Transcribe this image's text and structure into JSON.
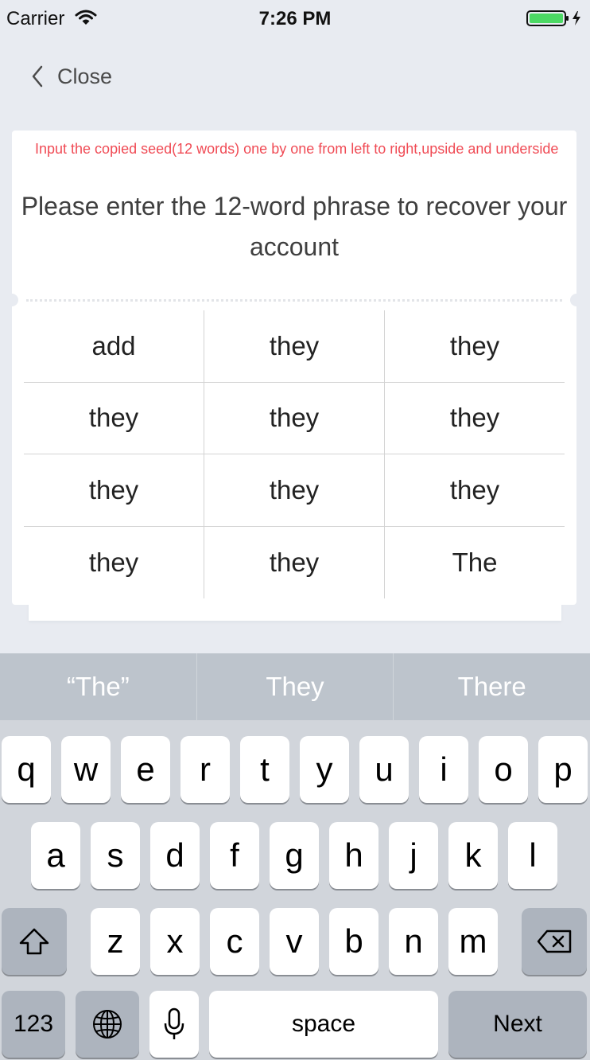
{
  "status": {
    "carrier": "Carrier",
    "time": "7:26 PM"
  },
  "nav": {
    "back_label": "Close"
  },
  "card": {
    "hint": "Input the copied seed(12 words) one by one from left to right,upside and underside",
    "title": "Please enter the 12-word phrase to recover your account",
    "words": [
      "add",
      "they",
      "they",
      "they",
      "they",
      "they",
      "they",
      "they",
      "they",
      "they",
      "they",
      "The"
    ]
  },
  "suggestions": [
    "“The”",
    "They",
    "There"
  ],
  "keyboard": {
    "row1": [
      "q",
      "w",
      "e",
      "r",
      "t",
      "y",
      "u",
      "i",
      "o",
      "p"
    ],
    "row2": [
      "a",
      "s",
      "d",
      "f",
      "g",
      "h",
      "j",
      "k",
      "l"
    ],
    "row3": [
      "z",
      "x",
      "c",
      "v",
      "b",
      "n",
      "m"
    ],
    "numbers_label": "123",
    "space_label": "space",
    "next_label": "Next"
  },
  "icons": {
    "wifi": "wifi-icon",
    "battery": "battery-icon",
    "back": "chevron-left-icon",
    "shift": "shift-icon",
    "delete": "backspace-icon",
    "globe": "globe-icon",
    "mic": "microphone-icon"
  },
  "colors": {
    "hint": "#f04b55",
    "battery": "#4cd964",
    "background": "#e8ebf1"
  }
}
